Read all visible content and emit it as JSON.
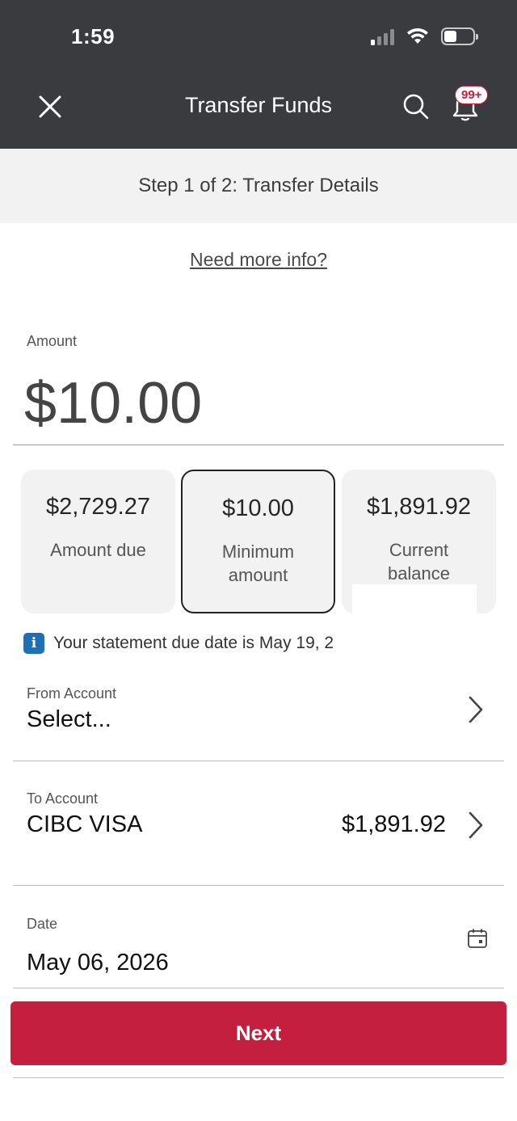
{
  "status_bar": {
    "time": "1:59"
  },
  "nav": {
    "title": "Transfer Funds",
    "badge": "99+"
  },
  "step": {
    "text": "Step 1 of 2: Transfer Details"
  },
  "info_link": "Need more info?",
  "amount": {
    "label": "Amount",
    "value": "$10.00"
  },
  "options": [
    {
      "value": "$2,729.27",
      "label": "Amount due",
      "selected": false
    },
    {
      "value": "$10.00",
      "label": "Minimum amount",
      "selected": true
    },
    {
      "value": "$1,891.92",
      "label": "Current balance",
      "selected": false
    }
  ],
  "due_note": "Your statement due date is May 19, 2",
  "from_account": {
    "label": "From Account",
    "value": "Select..."
  },
  "to_account": {
    "label": "To Account",
    "value": "CIBC VISA",
    "balance": "$1,891.92"
  },
  "date": {
    "label": "Date",
    "value": "May 06, 2026"
  },
  "next_button": "Next",
  "colors": {
    "header": "#3a3b3e",
    "accent": "#c41f3e",
    "info": "#1f6fb4"
  }
}
